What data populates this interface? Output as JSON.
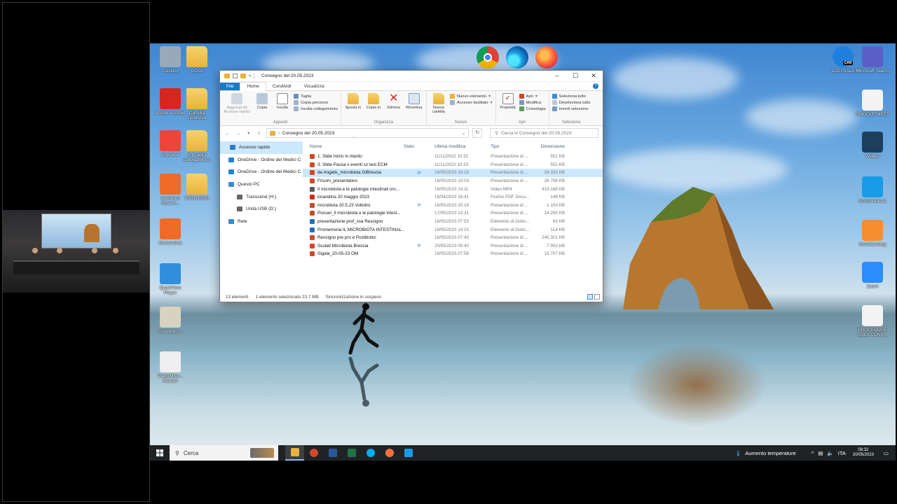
{
  "desktop": {
    "left_icons": [
      {
        "label": "Cestino",
        "color": "#9aa9b8"
      },
      {
        "label": "OGGI",
        "color": "#e8b33c"
      },
      {
        "label": "Adobe Acrobat",
        "color": "#d7261e"
      },
      {
        "label": "Cartella condivisa",
        "color": "#e8b33c"
      },
      {
        "label": "AnyDesk",
        "color": "#ef443b"
      },
      {
        "label": "Immagini collegamento",
        "color": "#e8b33c"
      },
      {
        "label": "Icecream Screen...",
        "color": "#f06a28"
      },
      {
        "label": "CONVEGNI",
        "color": "#e8b33c"
      },
      {
        "label": "Screenshot",
        "color": "#f06a28"
      },
      {
        "label": "QuickTime Player",
        "color": "#2f8fdd"
      },
      {
        "label": "Convegno...",
        "color": "#d8d2c0"
      },
      {
        "label": "PathoMiss... Reader",
        "color": "#eeeeee"
      }
    ],
    "right_icons": [
      {
        "label": "LUCI SALA",
        "badge": "CAN",
        "color": "#1f7fe0"
      },
      {
        "label": "Microsoft Teams",
        "color": "#5b5fc7"
      },
      {
        "label": "GOOGLE MEET",
        "color": "#f3f3f3"
      },
      {
        "label": "Webex",
        "color": "#1d3f5e"
      },
      {
        "label": "GoToWebinar",
        "color": "#1a9be8"
      },
      {
        "label": "GoToMeeting",
        "color": "#f68d2e"
      },
      {
        "label": "Zoom",
        "color": "#2d8cff"
      },
      {
        "label": "PROCEDURE SALA CONV...",
        "color": "#f3f3f3"
      }
    ],
    "top_icons": [
      "chrome-icon",
      "edge-icon",
      "firefox-icon"
    ]
  },
  "explorer": {
    "title": "Convegno del 20.05.2023",
    "tabs": [
      "File",
      "Home",
      "Condividi",
      "Visualizza"
    ],
    "active_tab": "Home",
    "ribbon": {
      "appunti": {
        "name": "Appunti",
        "pin": "Aggiungi ad Accesso rapido",
        "copy": "Copia",
        "paste": "Incolla",
        "cut": "Taglia",
        "copy_path": "Copia percorso",
        "paste_link": "Incolla collegamento"
      },
      "organizza": {
        "name": "Organizza",
        "move": "Sposta in",
        "copy_to": "Copia in",
        "delete": "Elimina",
        "rename": "Rinomina"
      },
      "nuovo": {
        "name": "Nuovo",
        "new_folder": "Nuova cartella",
        "new_item": "Nuovo elemento",
        "easy_access": "Accesso facilitato"
      },
      "apri": {
        "name": "Apri",
        "properties": "Proprietà",
        "open": "Apri",
        "edit": "Modifica",
        "history": "Cronologia"
      },
      "seleziona": {
        "name": "Seleziona",
        "select_all": "Seleziona tutto",
        "select_none": "Deseleziona tutto",
        "invert": "Inverti selezione"
      }
    },
    "address": "Convegno del 20.05.2023",
    "search_placeholder": "Cerca in Convegno del 20.05.2023",
    "nav": [
      {
        "label": "Accesso rapido",
        "color": "#2f78c8"
      },
      {
        "label": "OneDrive - Ordine dei Medici C",
        "color": "#1b86d8"
      },
      {
        "label": "OneDrive - Ordine dei Medici C",
        "color": "#1b86d8"
      },
      {
        "label": "Questo PC",
        "color": "#3b8ad4"
      },
      {
        "label": "Transcend (H:)",
        "color": "#666666"
      },
      {
        "label": "Unità USB (D:)",
        "color": "#666666"
      },
      {
        "label": "Rete",
        "color": "#3b8ad4"
      }
    ],
    "columns": [
      "Nome",
      "Stato",
      "Ultima modifica",
      "Tipo",
      "Dimensione"
    ],
    "files": [
      {
        "name": "1. Slide Inizio in ritardo",
        "stato": "",
        "date": "11/11/2022 10:32",
        "type": "Presentazione di ...",
        "size": "551 KB",
        "color": "#d24726"
      },
      {
        "name": "3. Slide Pausa x eventi sz test ECM",
        "stato": "",
        "date": "11/11/2022 10:33",
        "type": "Presentazione di ...",
        "size": "552 KB",
        "color": "#d24726"
      },
      {
        "name": "de Angelis_microbiota GIBrescia",
        "stato": "⟳",
        "date": "19/05/2023 19:18",
        "type": "Presentazione di ...",
        "size": "24.332 KB",
        "color": "#d24726"
      },
      {
        "name": "Frisoni_presentation",
        "stato": "",
        "date": "19/05/2023 10:03",
        "type": "Presentazione di ...",
        "size": "26.708 KB",
        "color": "#d24726"
      },
      {
        "name": "Il microbiota e le patologie intestinali cro...",
        "stato": "",
        "date": "19/05/2023 14:11",
        "type": "Video MP4",
        "size": "419.188 KB",
        "color": "#5a5a5a"
      },
      {
        "name": "locandina 20 maggio 2023",
        "stato": "",
        "date": "19/04/2023 16:41",
        "type": "Firefox PDF Docu...",
        "size": "148 KB",
        "color": "#d7261e"
      },
      {
        "name": "microbiota 20.5.23 Voltolini",
        "stato": "⟳",
        "date": "19/05/2023 20:16",
        "type": "Presentazione di ...",
        "size": "1.103 KB",
        "color": "#d24726"
      },
      {
        "name": "Porcari_Il microbiota e le patologie intest...",
        "stato": "",
        "date": "17/05/2023 13:31",
        "type": "Presentazione di ...",
        "size": "14.295 KB",
        "color": "#d24726"
      },
      {
        "name": "presentazione prof_ssa Rescigno",
        "stato": "",
        "date": "19/05/2023 07:53",
        "type": "Elemento di Outlo...",
        "size": "83 KB",
        "color": "#1e6fc2"
      },
      {
        "name": "Promemoria IL MICROBIOTA INTESTINAL...",
        "stato": "",
        "date": "19/05/2023 14:15",
        "type": "Elemento di Outlo...",
        "size": "114 KB",
        "color": "#1e6fc2"
      },
      {
        "name": "Rescigno pre pro e Postbiotici",
        "stato": "",
        "date": "19/05/2023 07:43",
        "type": "Presentazione di ...",
        "size": "245.301 KB",
        "color": "#d24726"
      },
      {
        "name": "Sculati Microbiota Brescia",
        "stato": "⟳",
        "date": "20/05/2023 00:40",
        "type": "Presentazione di ...",
        "size": "7.953 KB",
        "color": "#d24726"
      },
      {
        "name": "Sigala_20-05-23 OM",
        "stato": "",
        "date": "19/05/2023 07:58",
        "type": "Presentazione di ...",
        "size": "15.707 KB",
        "color": "#d24726"
      }
    ],
    "selected_index": 2,
    "status": {
      "count": "13 elementi",
      "selected": "1 elemento selezionato  23,7 MB",
      "sync": "Sincronizzazione in sospeso"
    }
  },
  "taskbar": {
    "search": "Cerca",
    "apps": [
      {
        "name": "explorer-icon",
        "color": "#e8b33c",
        "active": true
      },
      {
        "name": "powerpoint-icon",
        "color": "#d24726"
      },
      {
        "name": "word-icon",
        "color": "#2b579a"
      },
      {
        "name": "excel-icon",
        "color": "#217346"
      },
      {
        "name": "skype-icon",
        "color": "#00aff0"
      },
      {
        "name": "firefox-icon",
        "color": "#ff7139"
      },
      {
        "name": "gotowebinar-icon",
        "color": "#1a9be8"
      }
    ],
    "weather": "Aumento temperature",
    "lang": "ITA",
    "time": "08:32",
    "date": "20/05/2023"
  }
}
